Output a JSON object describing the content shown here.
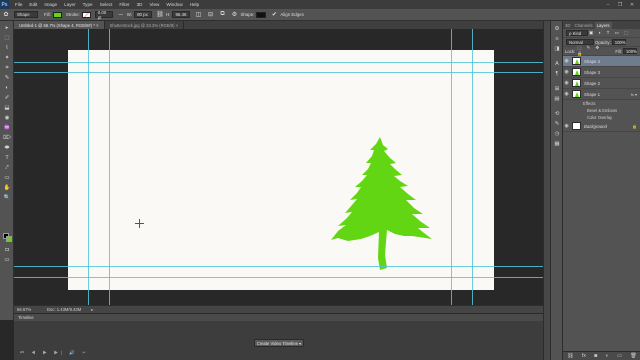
{
  "app": {
    "logo": "Ps"
  },
  "menu": [
    "File",
    "Edit",
    "Image",
    "Layer",
    "Type",
    "Select",
    "Filter",
    "3D",
    "View",
    "Window",
    "Help"
  ],
  "window_controls": [
    "–",
    "❐",
    "✕"
  ],
  "options": {
    "fill_label": "Fill:",
    "stroke_label": "Stroke:",
    "stroke_width": "0.00 pt",
    "w_label": "W:",
    "w_value": "80 px",
    "h_label": "H:",
    "h_value": "96.46",
    "shape_label": "Shape:",
    "align_label": "Align Edges",
    "tool_mode": "Shape",
    "fill_color": "#63d613"
  },
  "tabs": [
    {
      "label": "Untitled-1 @ 66.7% (Shape 4, RGB/8#) *  ×"
    },
    {
      "label": "Shutterstock.jpg @ 33.3% (RGB/8)  ×"
    }
  ],
  "tools": [
    "▸",
    "⬚",
    "⌇",
    "✦",
    "⌗",
    "✎",
    "◐",
    "✐",
    "⬓",
    "◉",
    "♒",
    "⌦",
    "⬬",
    "T",
    "⤤",
    "▭",
    "✋",
    "🔍"
  ],
  "right_strip_icons": [
    "⚙",
    "≡",
    "◨",
    "A",
    "¶",
    "⊞",
    "▤",
    "⟲",
    "✎",
    "◷",
    "▦"
  ],
  "status": {
    "zoom": "66.67%",
    "doc": "Doc: 1.43M/9.43M",
    "arrow": "▸"
  },
  "timeline": {
    "title": "Timeline",
    "create_button": "Create Video Timeline ▾",
    "controls": "⏮ ◀ ▶ ▶| 🔊 ✂"
  },
  "panel": {
    "tabs": [
      "3D",
      "Channels",
      "Layers"
    ],
    "kind_label": "ρ Kind",
    "blend_mode": "Normal",
    "opacity_label": "Opacity:",
    "opacity_value": "100%",
    "lock_label": "Lock:",
    "fill_label": "Fill:",
    "fill_value": "100%",
    "layers": [
      {
        "name": "Shape 4",
        "selected": true,
        "fx": ""
      },
      {
        "name": "Shape 3",
        "selected": false,
        "fx": ""
      },
      {
        "name": "Shape 2",
        "selected": false,
        "fx": ""
      },
      {
        "name": "Shape 1",
        "selected": false,
        "fx": "fx ▾"
      }
    ],
    "effects_label": "Effects",
    "effects": [
      "Bevel & Emboss",
      "Color Overlay"
    ],
    "background_layer": "Background",
    "footer_icons": [
      "⛓",
      "fx",
      "◙",
      "◐",
      "▭",
      "🗑"
    ]
  },
  "canvas": {
    "doc_bg": "#faf9f5",
    "tree_color": "#63d613"
  }
}
